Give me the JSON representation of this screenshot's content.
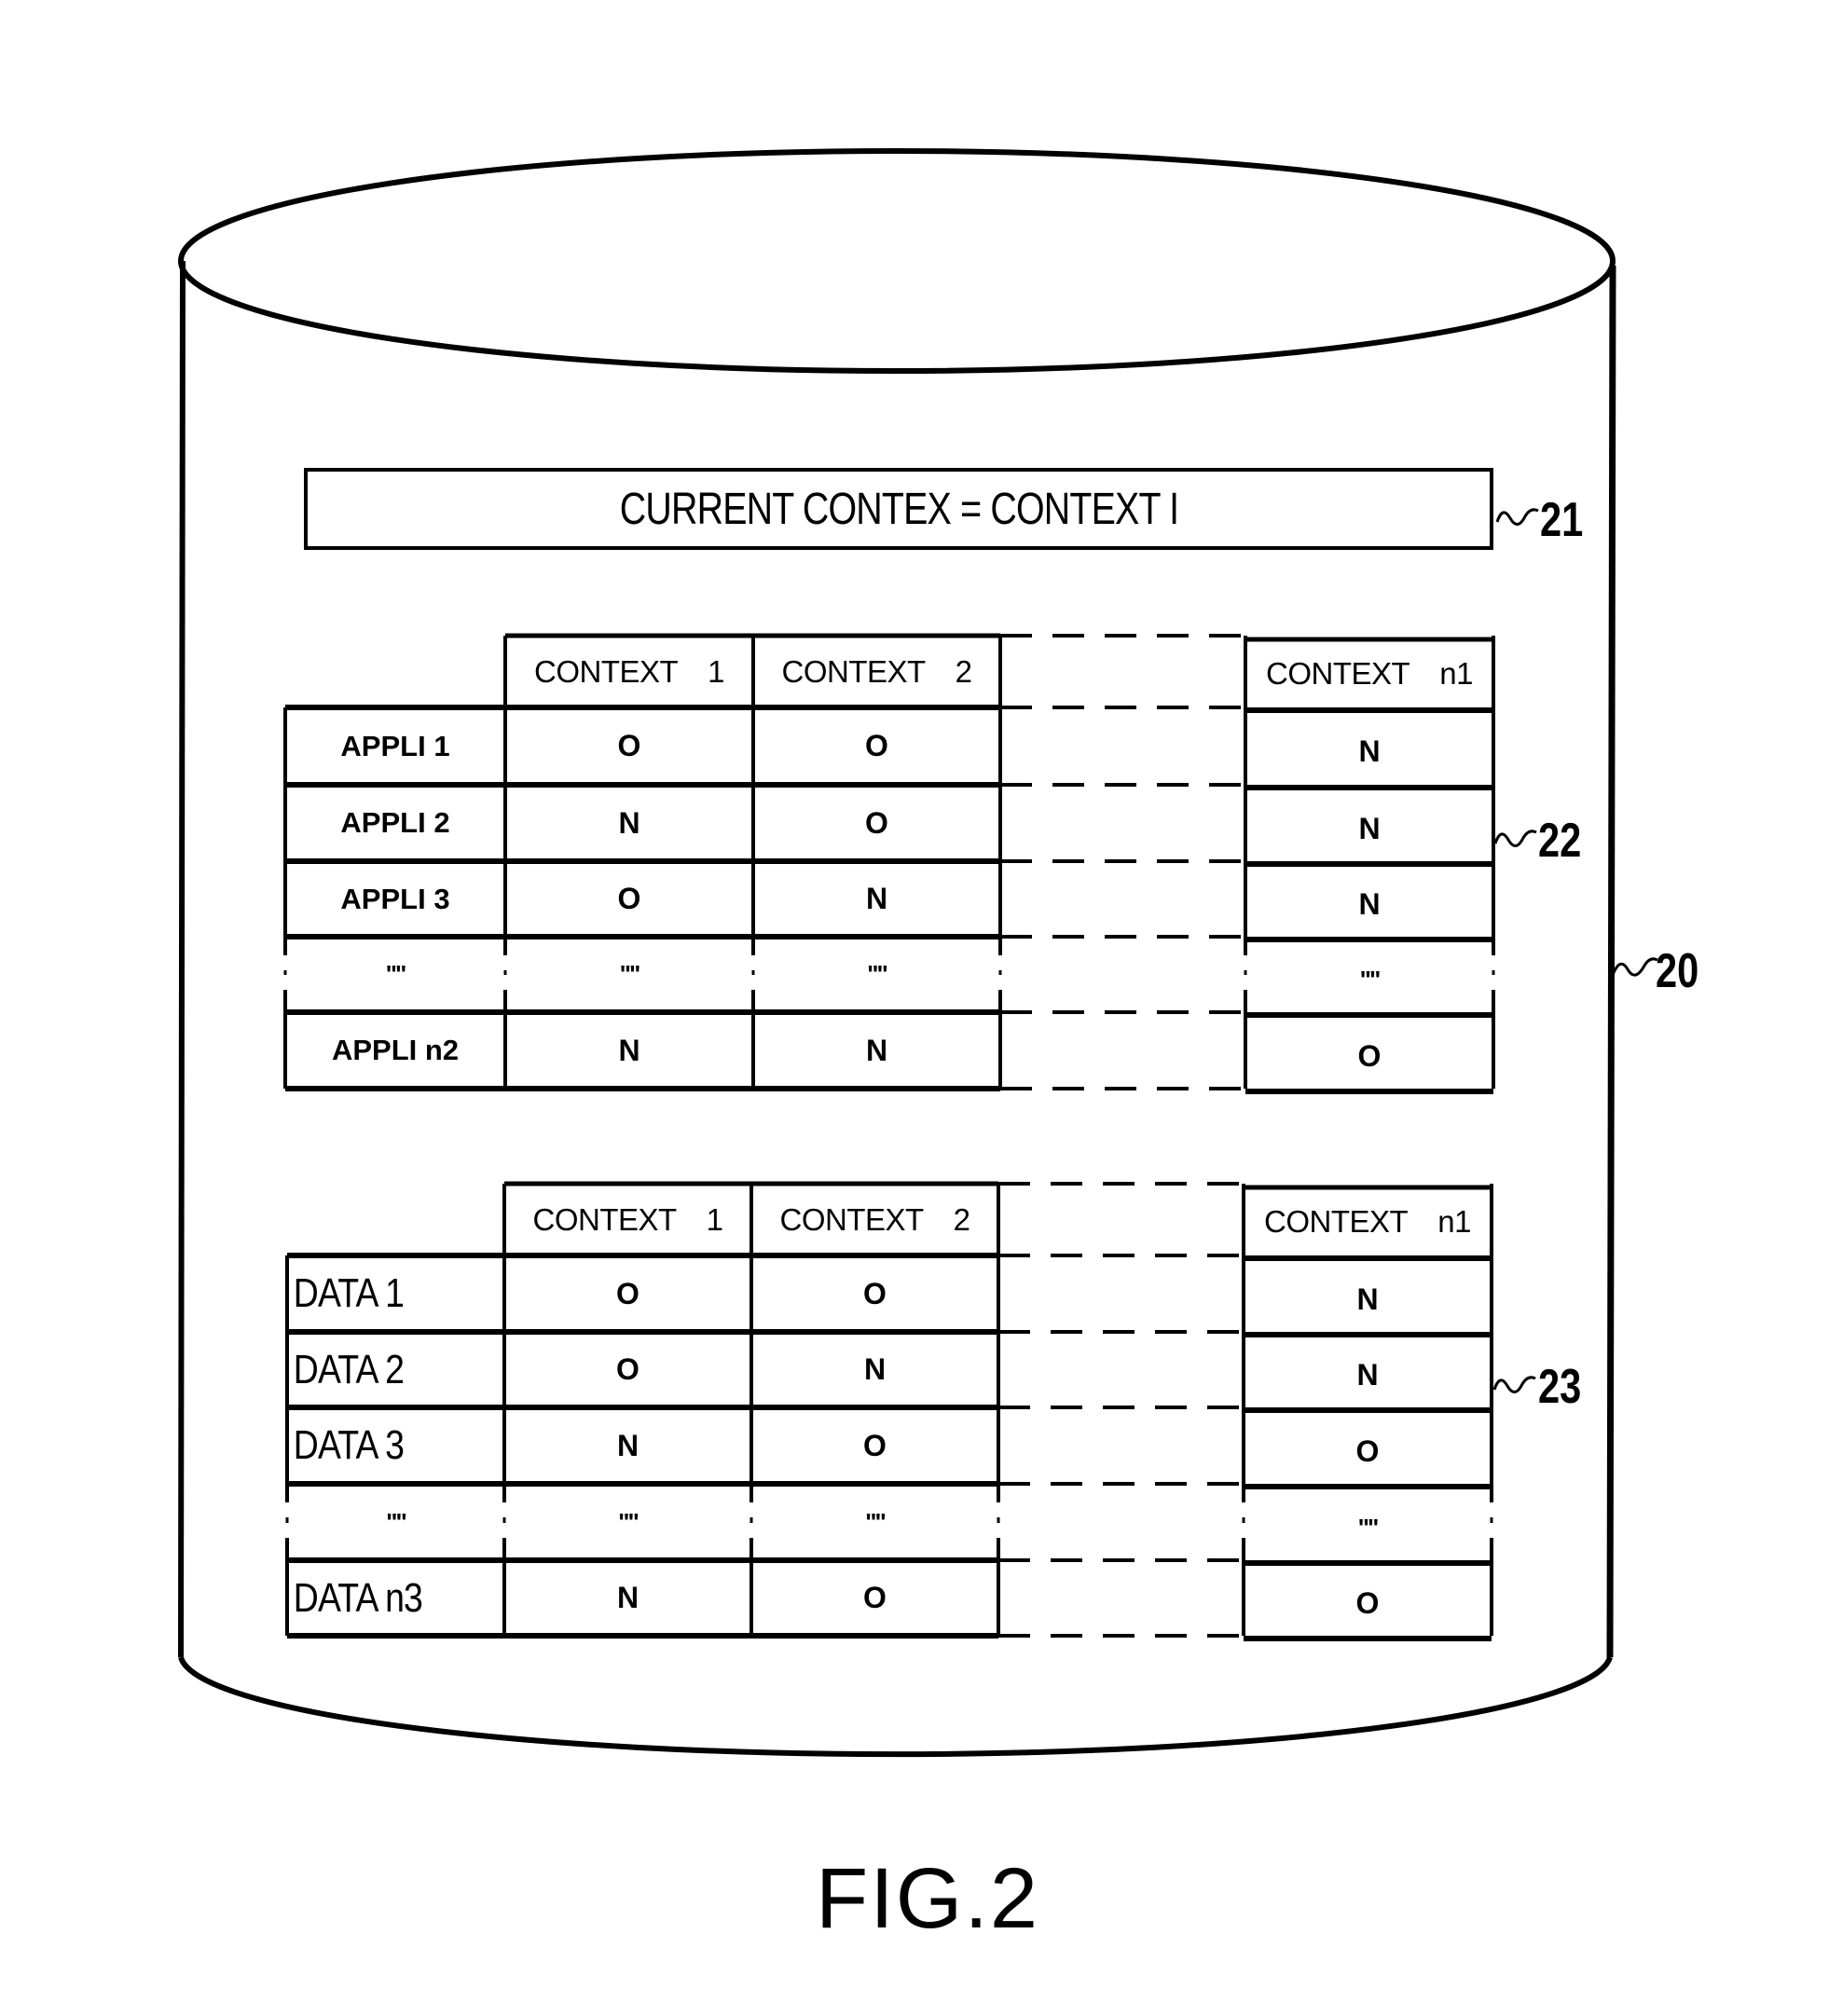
{
  "figure": {
    "caption": "FIG.2",
    "database_ref": "20"
  },
  "current_context_box": {
    "text": "CURRENT CONTEX = CONTEXT I",
    "ref": "21"
  },
  "applications_table": {
    "ref": "22",
    "columns": [
      {
        "label": "CONTEXT",
        "num": "1"
      },
      {
        "label": "CONTEXT",
        "num": "2"
      },
      {
        "label": "CONTEXT",
        "num": "n1"
      }
    ],
    "rows": [
      {
        "label": "APPLI 1",
        "values": [
          "O",
          "O",
          "N"
        ]
      },
      {
        "label": "APPLI 2",
        "values": [
          "N",
          "O",
          "N"
        ]
      },
      {
        "label": "APPLI 3",
        "values": [
          "O",
          "N",
          "N"
        ]
      },
      {
        "label": "\"\"",
        "values": [
          "\"\"",
          "\"\"",
          "\"\""
        ]
      },
      {
        "label": "APPLI n2",
        "values": [
          "N",
          "N",
          "O"
        ]
      }
    ]
  },
  "data_table": {
    "ref": "23",
    "columns": [
      {
        "label": "CONTEXT",
        "num": "1"
      },
      {
        "label": "CONTEXT",
        "num": "2"
      },
      {
        "label": "CONTEXT",
        "num": "n1"
      }
    ],
    "rows": [
      {
        "label": "DATA 1",
        "values": [
          "O",
          "O",
          "N"
        ]
      },
      {
        "label": "DATA 2",
        "values": [
          "O",
          "N",
          "N"
        ]
      },
      {
        "label": "DATA 3",
        "values": [
          "N",
          "O",
          "O"
        ]
      },
      {
        "label": "\"\"",
        "values": [
          "\"\"",
          "\"\"",
          "\"\""
        ]
      },
      {
        "label": "DATA n3",
        "values": [
          "N",
          "O",
          "O"
        ]
      }
    ]
  }
}
